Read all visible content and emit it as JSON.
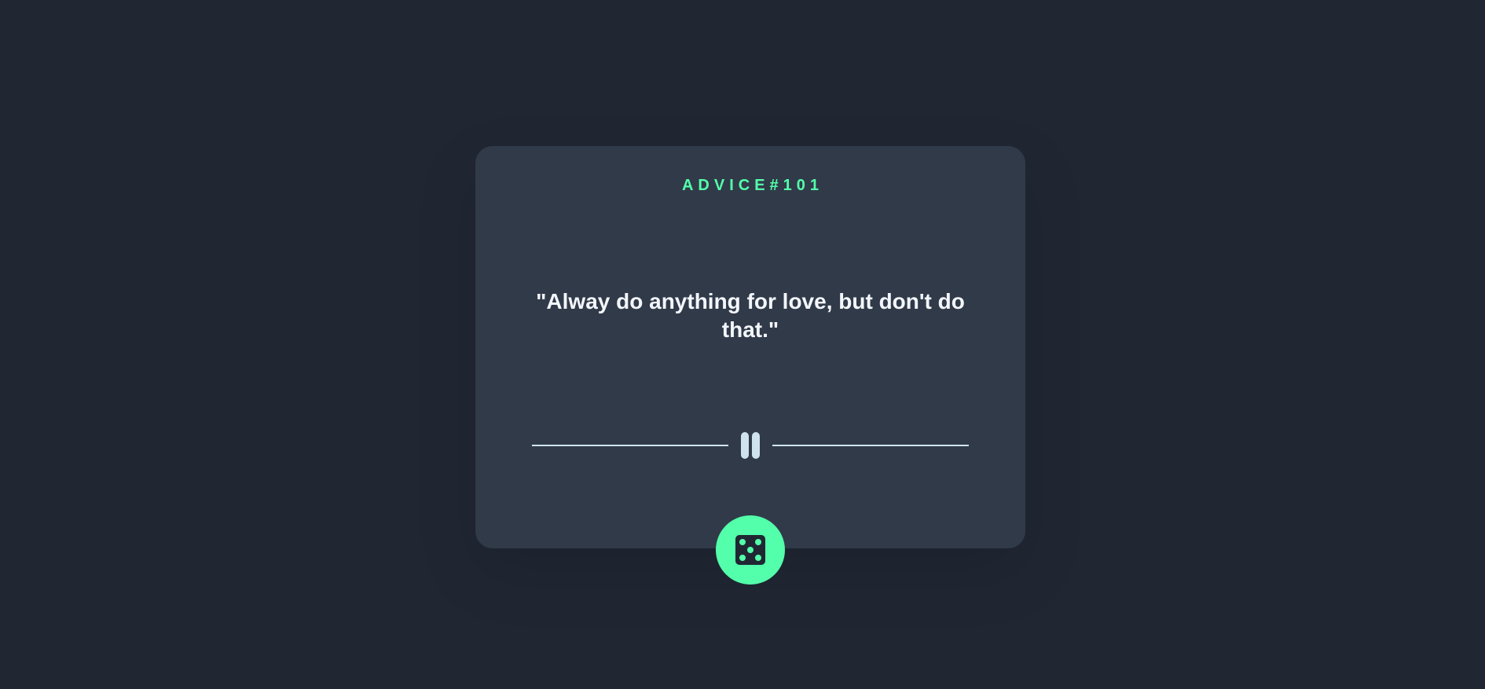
{
  "card": {
    "advice_id": "ADVICE#101",
    "quote": "\"Alway do anything for love, but don't do that.\""
  },
  "divider": {
    "icon": "pause-icon"
  },
  "action": {
    "icon": "dice-icon"
  },
  "colors": {
    "background": "#202733",
    "card": "#313a49",
    "accent": "#53ffaa",
    "text": "#f3f6fb",
    "divider": "#cfe3ef"
  }
}
